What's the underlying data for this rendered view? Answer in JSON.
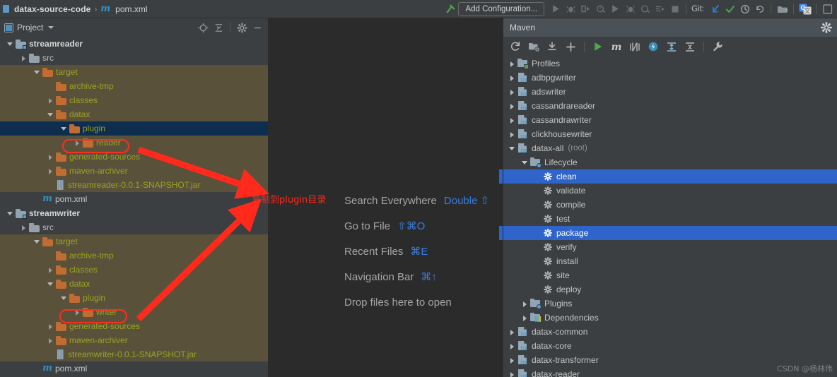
{
  "topbar": {
    "breadcrumb": {
      "project": "datax-source-code",
      "separator": "›",
      "file": "pom.xml",
      "file_icon": "maven-m-icon"
    },
    "add_configuration": "Add Configuration...",
    "git_label": "Git:",
    "icons": [
      "build-hammer-icon",
      "run-icon",
      "debug-icon",
      "run-with-coverage-icon",
      "profile-icon",
      "run2-icon",
      "debug2-icon",
      "coverage2-icon",
      "run-step-icon",
      "stop-icon",
      "git-update-icon",
      "git-commit-icon",
      "git-history-icon",
      "git-rollback-icon",
      "project-structure-icon",
      "google-translate-icon",
      "search-icon"
    ]
  },
  "project_panel": {
    "title": "Project",
    "header_icons": [
      "locate-target-icon",
      "collapse-all-icon",
      "gear-icon",
      "minimize-icon"
    ],
    "tree": [
      {
        "label": "streamreader",
        "depth": 0,
        "arrow": "down",
        "icon": "module-icon",
        "style": "mod"
      },
      {
        "label": "src",
        "depth": 1,
        "arrow": "right",
        "icon": "folder-gray-icon",
        "style": "src"
      },
      {
        "label": "target",
        "depth": 2,
        "arrow": "down",
        "icon": "folder-orange-icon",
        "style": "excl",
        "excluded": true
      },
      {
        "label": "archive-tmp",
        "depth": 3,
        "arrow": "none",
        "icon": "folder-orange-icon",
        "style": "excl",
        "excluded": true
      },
      {
        "label": "classes",
        "depth": 3,
        "arrow": "right",
        "icon": "folder-orange-icon",
        "style": "excl",
        "excluded": true
      },
      {
        "label": "datax",
        "depth": 3,
        "arrow": "down",
        "icon": "folder-orange-icon",
        "style": "excl",
        "excluded": true
      },
      {
        "label": "plugin",
        "depth": 4,
        "arrow": "down",
        "icon": "folder-orange-icon",
        "style": "excl",
        "excluded": true,
        "selected": true
      },
      {
        "label": "reader",
        "depth": 5,
        "arrow": "right",
        "icon": "folder-orange-icon",
        "style": "excl",
        "excluded": true,
        "highlighted": true
      },
      {
        "label": "generated-sources",
        "depth": 3,
        "arrow": "right",
        "icon": "folder-orange-icon",
        "style": "excl",
        "excluded": true
      },
      {
        "label": "maven-archiver",
        "depth": 3,
        "arrow": "right",
        "icon": "folder-orange-icon",
        "style": "excl",
        "excluded": true
      },
      {
        "label": "streamreader-0.0.1-SNAPSHOT.jar",
        "depth": 3,
        "arrow": "none",
        "icon": "jar-icon",
        "style": "jar",
        "excluded": true
      },
      {
        "label": "pom.xml",
        "depth": 2,
        "arrow": "none",
        "icon": "maven-m-icon",
        "style": "pom"
      },
      {
        "label": "streamwriter",
        "depth": 0,
        "arrow": "down",
        "icon": "module-icon",
        "style": "mod"
      },
      {
        "label": "src",
        "depth": 1,
        "arrow": "right",
        "icon": "folder-gray-icon",
        "style": "src"
      },
      {
        "label": "target",
        "depth": 2,
        "arrow": "down",
        "icon": "folder-orange-icon",
        "style": "excl",
        "excluded": true
      },
      {
        "label": "archive-tmp",
        "depth": 3,
        "arrow": "none",
        "icon": "folder-orange-icon",
        "style": "excl",
        "excluded": true
      },
      {
        "label": "classes",
        "depth": 3,
        "arrow": "right",
        "icon": "folder-orange-icon",
        "style": "excl",
        "excluded": true
      },
      {
        "label": "datax",
        "depth": 3,
        "arrow": "down",
        "icon": "folder-orange-icon",
        "style": "excl",
        "excluded": true
      },
      {
        "label": "plugin",
        "depth": 4,
        "arrow": "down",
        "icon": "folder-orange-icon",
        "style": "excl",
        "excluded": true
      },
      {
        "label": "writer",
        "depth": 5,
        "arrow": "right",
        "icon": "folder-orange-icon",
        "style": "excl",
        "excluded": true,
        "highlighted": true
      },
      {
        "label": "generated-sources",
        "depth": 3,
        "arrow": "right",
        "icon": "folder-orange-icon",
        "style": "excl",
        "excluded": true
      },
      {
        "label": "maven-archiver",
        "depth": 3,
        "arrow": "right",
        "icon": "folder-orange-icon",
        "style": "excl",
        "excluded": true
      },
      {
        "label": "streamwriter-0.0.1-SNAPSHOT.jar",
        "depth": 3,
        "arrow": "none",
        "icon": "jar-icon",
        "style": "jar",
        "excluded": true
      },
      {
        "label": "pom.xml",
        "depth": 2,
        "arrow": "none",
        "icon": "maven-m-icon",
        "style": "pom"
      }
    ]
  },
  "annotation": {
    "text": "复制到plugin目录",
    "color": "#ff2a1c"
  },
  "editor": {
    "hints": [
      {
        "action": "Search Everywhere",
        "shortcut": "Double ⇧"
      },
      {
        "action": "Go to File",
        "shortcut": "⇧⌘O"
      },
      {
        "action": "Recent Files",
        "shortcut": "⌘E"
      },
      {
        "action": "Navigation Bar",
        "shortcut": "⌘↑"
      },
      {
        "action": "Drop files here to open",
        "shortcut": ""
      }
    ]
  },
  "maven_panel": {
    "title": "Maven",
    "header_icons": [
      "gear-icon"
    ],
    "toolbar_icons": [
      "reload-icon",
      "add-managed-files-icon",
      "download-sources-icon",
      "plus-icon",
      "run-icon",
      "execute-maven-goal-icon",
      "toggle-skip-tests-icon",
      "toggle-offline-icon",
      "expand-all-icon",
      "collapse-all-icon",
      "wrench-settings-icon"
    ],
    "tree": [
      {
        "label": "Profiles",
        "depth": 0,
        "arrow": "right",
        "icon": "profiles-folder-icon"
      },
      {
        "label": "adbpgwriter",
        "depth": 0,
        "arrow": "right",
        "icon": "maven-project-icon"
      },
      {
        "label": "adswriter",
        "depth": 0,
        "arrow": "right",
        "icon": "maven-project-icon"
      },
      {
        "label": "cassandrareader",
        "depth": 0,
        "arrow": "right",
        "icon": "maven-project-icon"
      },
      {
        "label": "cassandrawriter",
        "depth": 0,
        "arrow": "right",
        "icon": "maven-project-icon"
      },
      {
        "label": "clickhousewriter",
        "depth": 0,
        "arrow": "right",
        "icon": "maven-project-icon"
      },
      {
        "label": "datax-all",
        "suffix": "(root)",
        "depth": 0,
        "arrow": "down",
        "icon": "maven-project-icon"
      },
      {
        "label": "Lifecycle",
        "depth": 1,
        "arrow": "down",
        "icon": "lifecycle-folder-icon"
      },
      {
        "label": "clean",
        "depth": 2,
        "arrow": "none",
        "icon": "goal-gear-icon",
        "selected": true
      },
      {
        "label": "validate",
        "depth": 2,
        "arrow": "none",
        "icon": "goal-gear-icon"
      },
      {
        "label": "compile",
        "depth": 2,
        "arrow": "none",
        "icon": "goal-gear-icon"
      },
      {
        "label": "test",
        "depth": 2,
        "arrow": "none",
        "icon": "goal-gear-icon"
      },
      {
        "label": "package",
        "depth": 2,
        "arrow": "none",
        "icon": "goal-gear-icon",
        "selected": true
      },
      {
        "label": "verify",
        "depth": 2,
        "arrow": "none",
        "icon": "goal-gear-icon"
      },
      {
        "label": "install",
        "depth": 2,
        "arrow": "none",
        "icon": "goal-gear-icon"
      },
      {
        "label": "site",
        "depth": 2,
        "arrow": "none",
        "icon": "goal-gear-icon"
      },
      {
        "label": "deploy",
        "depth": 2,
        "arrow": "none",
        "icon": "goal-gear-icon"
      },
      {
        "label": "Plugins",
        "depth": 1,
        "arrow": "right",
        "icon": "plugins-folder-icon"
      },
      {
        "label": "Dependencies",
        "depth": 1,
        "arrow": "right",
        "icon": "dependencies-folder-icon"
      },
      {
        "label": "datax-common",
        "depth": 0,
        "arrow": "right",
        "icon": "maven-project-icon"
      },
      {
        "label": "datax-core",
        "depth": 0,
        "arrow": "right",
        "icon": "maven-project-icon"
      },
      {
        "label": "datax-transformer",
        "depth": 0,
        "arrow": "right",
        "icon": "maven-project-icon"
      },
      {
        "label": "datax-reader",
        "depth": 0,
        "arrow": "right",
        "icon": "maven-project-icon"
      }
    ]
  },
  "watermark": "CSDN @杨林伟",
  "colors": {
    "panel_bg": "#3c3f41",
    "editor_bg": "#2b2b2b",
    "excluded_bg": "#5a513b",
    "excluded_text": "#9aa520",
    "selection_blue": "#2f65ca",
    "selection_nav": "#0d2e4f",
    "accent_red": "#ff2d20",
    "link_blue": "#3b7ddd"
  }
}
